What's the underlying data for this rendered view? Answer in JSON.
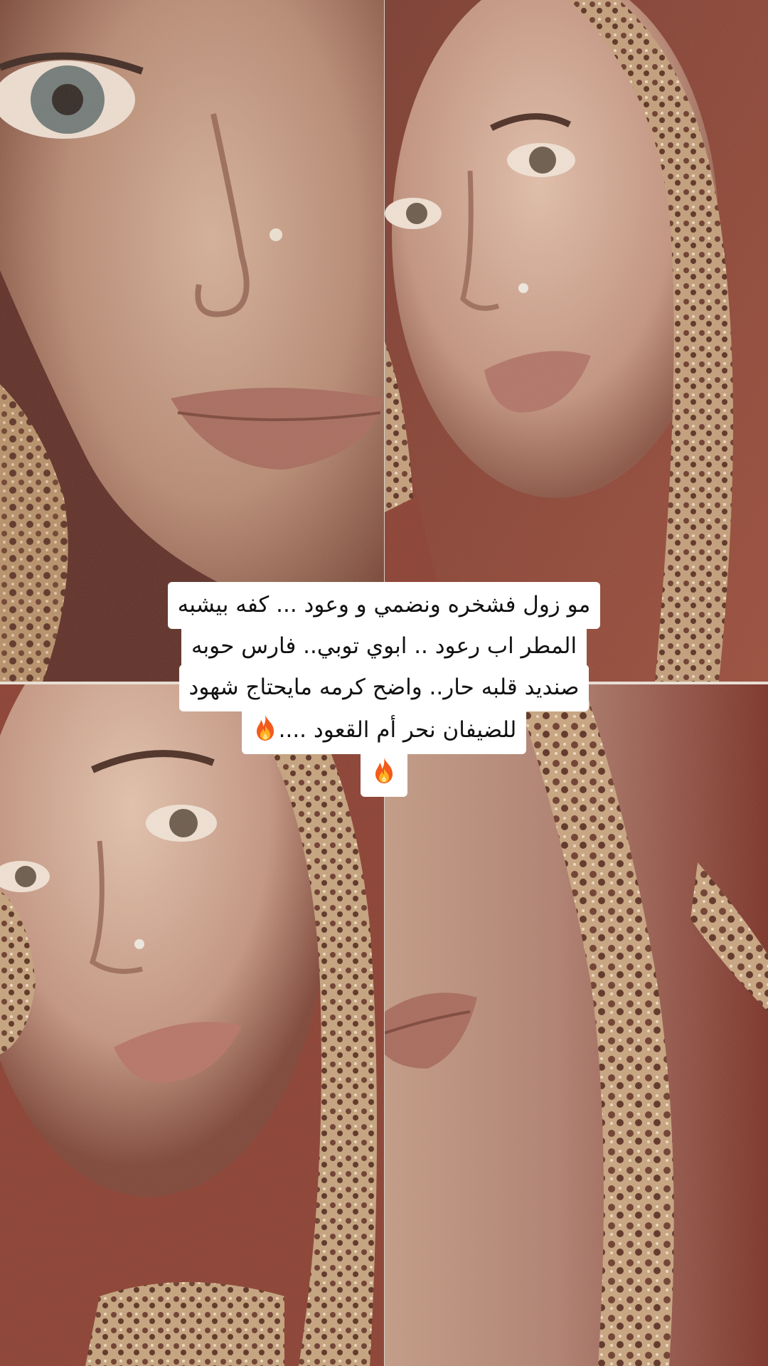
{
  "caption": {
    "lines": [
      "مو زول فشخره ونضمي و وعود ... كفه بيشبه",
      "المطر اب رعود .. ابوي توبي.. فارس حوبه",
      "صنديد قلبه حار.. واضح كرمه مايحتاج شهود",
      "للضيفان نحر أم القعود ....",
      ""
    ],
    "emoji": "fire-emoji"
  },
  "photos": [
    {
      "name": "photo-top-left",
      "subject": "close-up-face-with-nose-ring"
    },
    {
      "name": "photo-top-right",
      "subject": "face-with-embroidered-veil"
    },
    {
      "name": "photo-bottom-left",
      "subject": "face-with-embroidered-veil"
    },
    {
      "name": "photo-bottom-right",
      "subject": "close-up-lips-and-veil"
    }
  ],
  "colors": {
    "background": "#ffffff",
    "caption_bg": "#ffffff",
    "caption_text": "#111111",
    "photo_tone": "#8a4a38",
    "skin_tone": "#c79a80",
    "veil_gold": "#c8a27a"
  }
}
